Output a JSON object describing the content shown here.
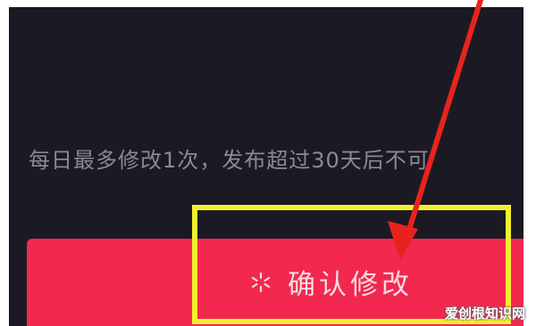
{
  "hint_text": "每日最多修改1次，发布超过30天后不可",
  "confirm_button": {
    "label": "确认修改",
    "icon": "loading-spinner-icon"
  },
  "annotation": {
    "highlight_color": "#f4f02c",
    "arrow_color": "#e8231e"
  },
  "watermark": "爱创根知识网",
  "colors": {
    "background": "#1b1a24",
    "button": "#f2284f"
  }
}
